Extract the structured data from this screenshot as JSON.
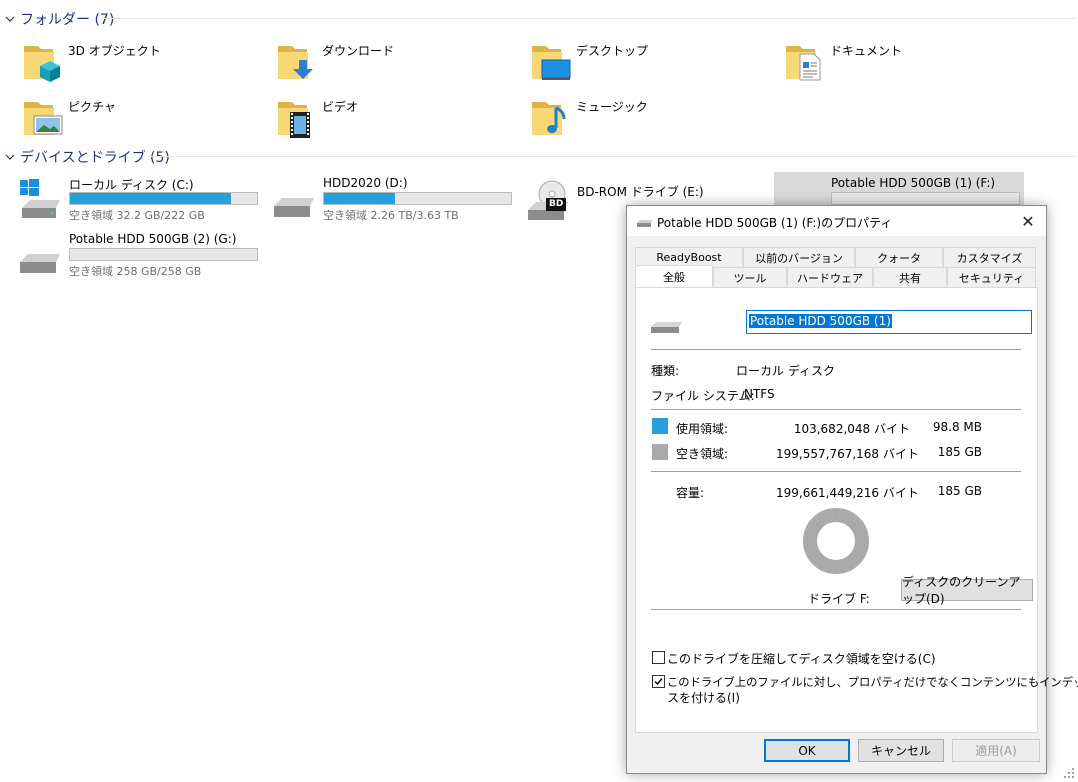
{
  "folders_section": {
    "title": "フォルダー (7)",
    "items": [
      {
        "label": "3D オブジェクト",
        "icon": "3d-objects-folder-icon"
      },
      {
        "label": "ダウンロード",
        "icon": "downloads-folder-icon"
      },
      {
        "label": "デスクトップ",
        "icon": "desktop-folder-icon"
      },
      {
        "label": "ドキュメント",
        "icon": "documents-folder-icon"
      },
      {
        "label": "ピクチャ",
        "icon": "pictures-folder-icon"
      },
      {
        "label": "ビデオ",
        "icon": "videos-folder-icon"
      },
      {
        "label": "ミュージック",
        "icon": "music-folder-icon"
      }
    ]
  },
  "drives_section": {
    "title": "デバイスとドライブ (5)",
    "drives": [
      {
        "name": "ローカル ディスク (C:)",
        "free": "空き領域 32.2 GB/222 GB",
        "used_fraction": 0.86
      },
      {
        "name": "HDD2020 (D:)",
        "free": "空き領域 2.26 TB/3.63 TB",
        "used_fraction": 0.38
      },
      {
        "name": "BD-ROM ドライブ (E:)",
        "badge": "BD"
      },
      {
        "name": "Potable HDD 500GB (1) (F:)"
      },
      {
        "name": "Potable HDD 500GB (2) (G:)",
        "free": "空き領域 258 GB/258 GB",
        "used_fraction": 0.0
      }
    ]
  },
  "dialog": {
    "title": "Potable HDD 500GB (1) (F:)のプロパティ",
    "close": "✕",
    "tabs_row1": [
      "ReadyBoost",
      "以前のバージョン",
      "クォータ",
      "カスタマイズ"
    ],
    "tabs_row2": [
      "全般",
      "ツール",
      "ハードウェア",
      "共有",
      "セキュリティ"
    ],
    "active_tab": "全般",
    "volume_name": "Potable HDD 500GB (1)",
    "type_label": "種類:",
    "type_value": "ローカル ディスク",
    "fs_label": "ファイル システム:",
    "fs_value": "NTFS",
    "used_label": "使用領域:",
    "used_bytes": "103,682,048 バイト",
    "used_human": "98.8 MB",
    "free_label": "空き領域:",
    "free_bytes": "199,557,767,168 バイト",
    "free_human": "185 GB",
    "capacity_label": "容量:",
    "capacity_bytes": "199,661,449,216 バイト",
    "capacity_human": "185 GB",
    "used_fraction": 0.0005,
    "drive_label": "ドライブ F:",
    "cleanup_button": "ディスクのクリーンアップ(D)",
    "compress_label": "このドライブを圧縮してディスク領域を空ける(C)",
    "compress_checked": false,
    "index_label_line1": "このドライブ上のファイルに対し、プロパティだけでなくコンテンツにもインデックス",
    "index_label_line2": "スを付ける(I)",
    "index_checked": true,
    "ok_button": "OK",
    "cancel_button": "キャンセル",
    "apply_button": "適用(A)",
    "colors": {
      "used": "#26a0da",
      "free": "#aaaaaa"
    }
  }
}
